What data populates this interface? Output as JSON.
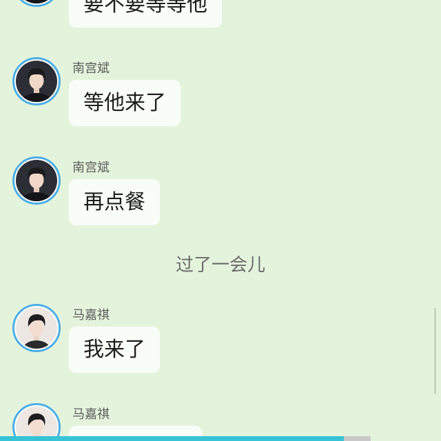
{
  "theme": {
    "background": "#e4f4dc",
    "bubble": "#f9fdf7",
    "avatar_ring": "#4daee6",
    "notice_text": "#6b6b6b",
    "progress_played": "#36c3d6",
    "progress_buffered": "#c9c9c9"
  },
  "chat": {
    "messages": [
      {
        "avatar": "avatar-photo-dark",
        "text": "要不要等等他"
      },
      {
        "sender": "南宫斌",
        "avatar": "avatar-photo-dark",
        "text": "等他来了"
      },
      {
        "sender": "南宫斌",
        "avatar": "avatar-photo-dark",
        "text": "再点餐"
      },
      {
        "sender": "马嘉祺",
        "avatar": "avatar-photo-light",
        "text": "我来了"
      },
      {
        "sender": "马嘉祺",
        "avatar": "avatar-photo-light"
      }
    ],
    "notice": "过了一会儿"
  },
  "playback": {
    "played": 0.78,
    "buffered": 0.84
  }
}
